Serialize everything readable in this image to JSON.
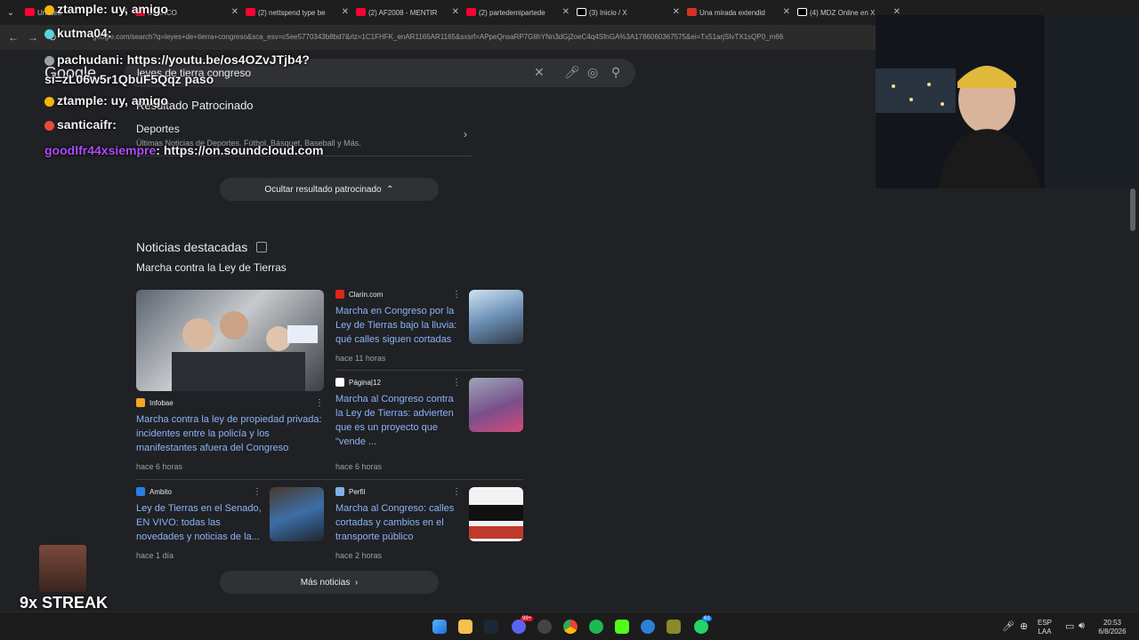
{
  "tabs": [
    {
      "label": "Untitled",
      "color": "#ff0033"
    },
    {
      "label": "BLANCO",
      "color": "#ff0033"
    },
    {
      "label": "(2) nettspend type be",
      "color": "#ff0033"
    },
    {
      "label": "(2) AF2008 - MENTIR",
      "color": "#ff0033"
    },
    {
      "label": "(2) partedemipartede",
      "color": "#ff0033"
    },
    {
      "label": "(3) Inicio / X",
      "color": "#ffffff"
    },
    {
      "label": "Una mirada extendid",
      "color": "#d93025"
    },
    {
      "label": "(4) MDZ Online en X",
      "color": "#ffffff"
    }
  ],
  "address": {
    "url": "google.com/search?q=leyes+de+tierra+congreso&sca_esv=c5ee5770343b8bd7&rlz=1C1FHFK_enAR1165AR1165&sxsrf=APpeQnsaRP7GIlhYNn3dGj2oeC4q4SfnGA%3A1786060367575&ei=Tx51arjSIvTX1sQP0_m66"
  },
  "google": {
    "logo": "Google",
    "query": "leyes de tierra congreso"
  },
  "sponsored": {
    "title": "Resultado Patrocinado",
    "item_title": "Deportes",
    "item_desc": "Últimas Noticias de Deportes. Fútbol, Básquet, Baseball y Más.",
    "hide_label": "Ocultar resultado patrocinado"
  },
  "news": {
    "heading": "Noticias destacadas",
    "subheading": "Marcha contra la Ley de Tierras",
    "more_label": "Más noticias",
    "items": [
      {
        "source": "Clarin.com",
        "title": "Marcha en Congreso por la Ley de Tierras bajo la lluvia: qué calles siguen cortadas",
        "age": "hace 11 horas"
      },
      {
        "source": "Página|12",
        "title": "Marcha al Congreso contra la Ley de Tierras: advierten que es un proyecto que \"vende ...",
        "age": "hace 6 horas"
      },
      {
        "source": "Infobae",
        "title": "Marcha contra la ley de propiedad privada: incidentes entre la policía y los manifestantes afuera del Congreso",
        "age": "hace 6 horas"
      },
      {
        "source": "Ambito",
        "title": "Ley de Tierras en el Senado, EN VIVO: todas las novedades y noticias de la...",
        "age": "hace 1 día"
      },
      {
        "source": "Perfil",
        "title": "Marcha al Congreso: calles cortadas y cambios en el transporte público",
        "age": "hace 2 horas"
      }
    ]
  },
  "chat": [
    {
      "user": "ztample",
      "msg": ": uy, amigo",
      "color": "#ffffff"
    },
    {
      "user": "kutma04",
      "msg": ":",
      "color": "#ffffff"
    },
    {
      "user": "pachudani",
      "msg": ": https://youtu.be/os4OZvJTjb4?si=zL06w5r1QbuF5Qqz paso",
      "color": "#ffffff"
    },
    {
      "user": "ztample",
      "msg": ": uy, amigo",
      "color": "#ffffff"
    },
    {
      "user": "santicaifr",
      "msg": ":",
      "color": "#ffffff"
    },
    {
      "user": "goodlfr44xsiempre",
      "msg": ": https://on.soundcloud.com",
      "color": "#b04cff"
    }
  ],
  "streak": "9x STREAK",
  "tray": {
    "lang": "ESP",
    "layout": "LAA",
    "time": "20:53",
    "date": "6/8/2026"
  },
  "taskbar_badges": {
    "discord": "99+",
    "whatsapp": "63"
  }
}
